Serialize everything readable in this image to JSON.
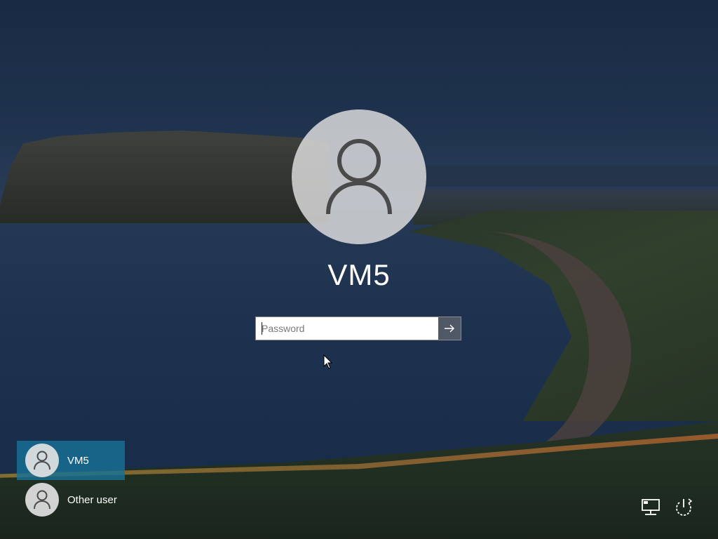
{
  "login": {
    "username": "VM5",
    "password_placeholder": "Password",
    "password_value": ""
  },
  "user_list": [
    {
      "name": "VM5",
      "selected": true
    },
    {
      "name": "Other user",
      "selected": false
    }
  ],
  "icons": {
    "avatar": "user-silhouette-icon",
    "submit": "arrow-right-icon",
    "network": "network-icon",
    "power": "power-icon",
    "cursor": "mouse-pointer-icon"
  },
  "colors": {
    "selected_user_bg": "#1870a0",
    "submit_button_bg": "#4f5864"
  }
}
